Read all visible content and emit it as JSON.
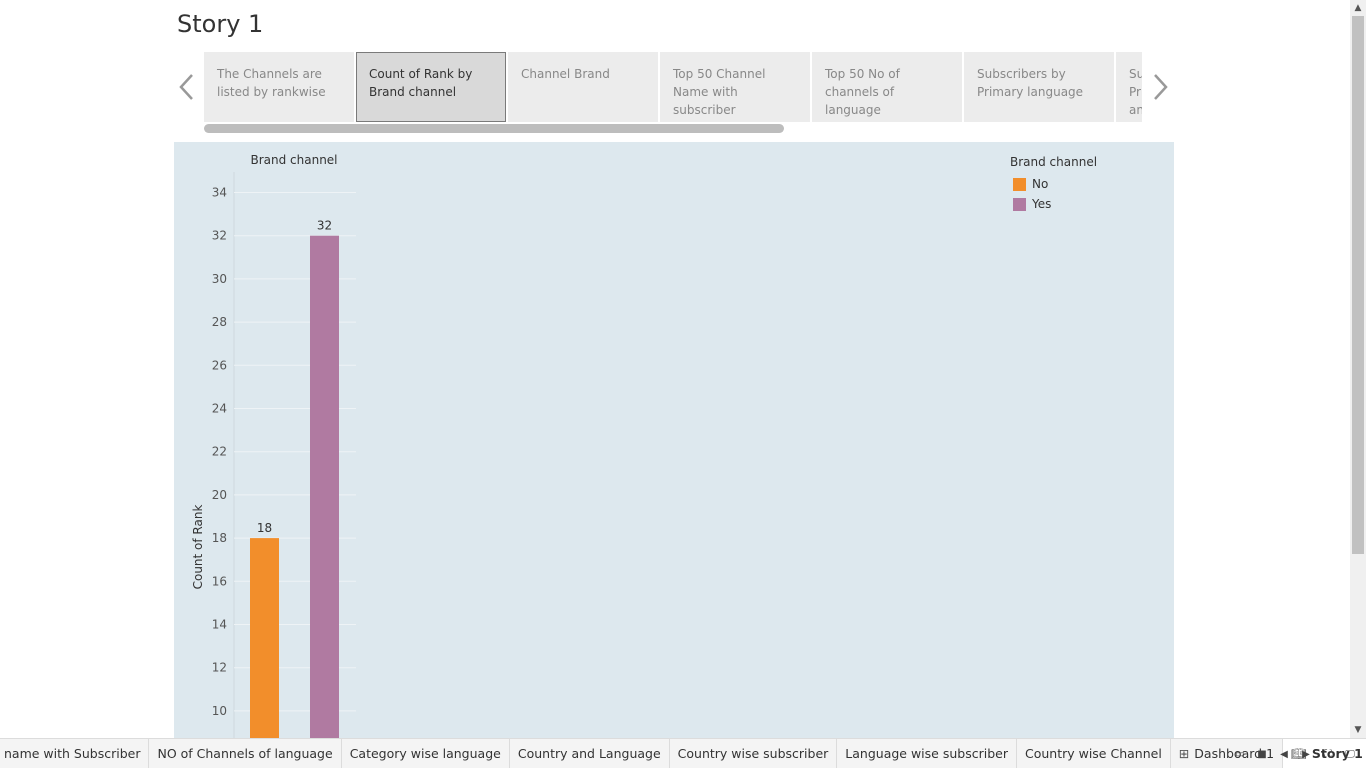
{
  "story": {
    "title": "Story 1"
  },
  "story_points": [
    "The Channels are listed by rankwise",
    "Count of Rank by Brand channel",
    "Channel Brand",
    "Top 50 Channel Name with subscriber",
    "Top 50 No of channels of language",
    "Subscribers by Primary language",
    "Subscribers by Primary language and Country"
  ],
  "colors": {
    "no": "#f28e2b",
    "yes": "#b07aa1",
    "viz_bg": "#dde8ee"
  },
  "legend": {
    "title": "Brand channel",
    "items": [
      {
        "label": "No",
        "color": "#f28e2b"
      },
      {
        "label": "Yes",
        "color": "#b07aa1"
      }
    ]
  },
  "chart_data": {
    "type": "bar",
    "title": "Brand channel",
    "xlabel": "",
    "ylabel": "Count of Rank",
    "categories": [
      "No",
      "Yes"
    ],
    "values": [
      18,
      32
    ],
    "data_labels": [
      "18",
      "32"
    ],
    "yticks": [
      10,
      12,
      14,
      16,
      18,
      20,
      22,
      24,
      26,
      28,
      30,
      32,
      34
    ],
    "ylim_visible": [
      9,
      35
    ],
    "grid": true,
    "legend_position": "top-right"
  },
  "tabs": [
    {
      "label": "name with Subscriber",
      "icon": ""
    },
    {
      "label": "NO of Channels of language",
      "icon": ""
    },
    {
      "label": "Category wise language",
      "icon": ""
    },
    {
      "label": "Country and Language",
      "icon": ""
    },
    {
      "label": "Country wise subscriber",
      "icon": ""
    },
    {
      "label": "Language wise subscriber",
      "icon": ""
    },
    {
      "label": "Country wise Channel",
      "icon": ""
    },
    {
      "label": "Dashboard 1",
      "icon": "dashboard-icon"
    },
    {
      "label": "Story 1",
      "icon": "story-icon"
    }
  ]
}
